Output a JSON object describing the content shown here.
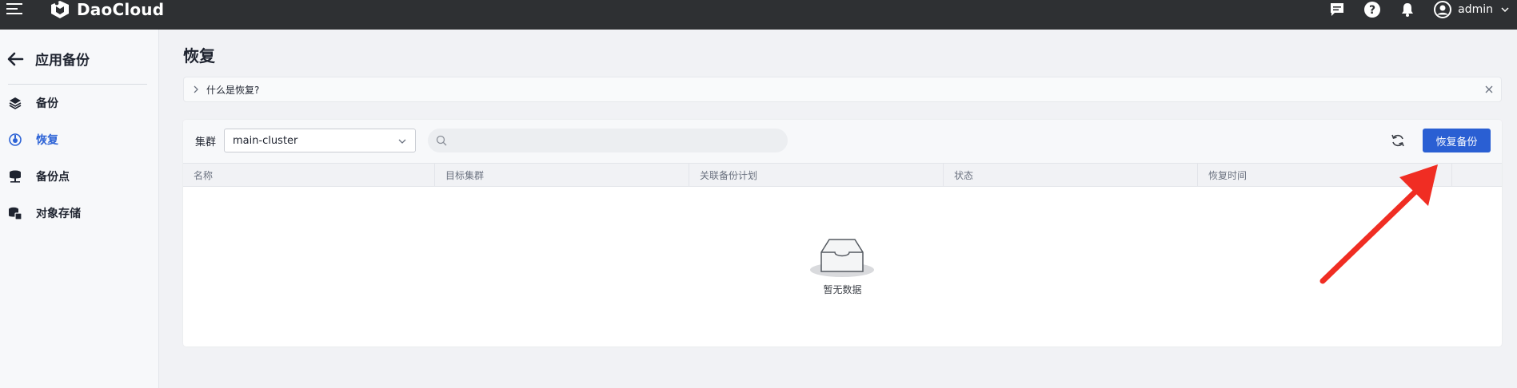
{
  "topbar": {
    "brand": "DaoCloud",
    "user": "admin",
    "icons": [
      "message-icon",
      "help-icon",
      "bell-icon",
      "user-avatar-icon"
    ]
  },
  "sidebar": {
    "title": "应用备份",
    "items": [
      {
        "label": "备份",
        "icon": "layers-icon",
        "active": false
      },
      {
        "label": "恢复",
        "icon": "restore-icon",
        "active": true
      },
      {
        "label": "备份点",
        "icon": "database-icon",
        "active": false
      },
      {
        "label": "对象存储",
        "icon": "storage-icon",
        "active": false
      }
    ]
  },
  "main": {
    "title": "恢复",
    "info": "什么是恢复?",
    "filter_label": "集群",
    "cluster": "main-cluster",
    "search_placeholder": "",
    "restore_button": "恢复备份",
    "columns": [
      "名称",
      "目标集群",
      "关联备份计划",
      "状态",
      "恢复时间",
      ""
    ],
    "empty_text": "暂无数据"
  },
  "colors": {
    "topbar": "#2e3033",
    "primary": "#2a5fd3",
    "active": "#2d63d6",
    "annotation_arrow": "#f02d23"
  }
}
